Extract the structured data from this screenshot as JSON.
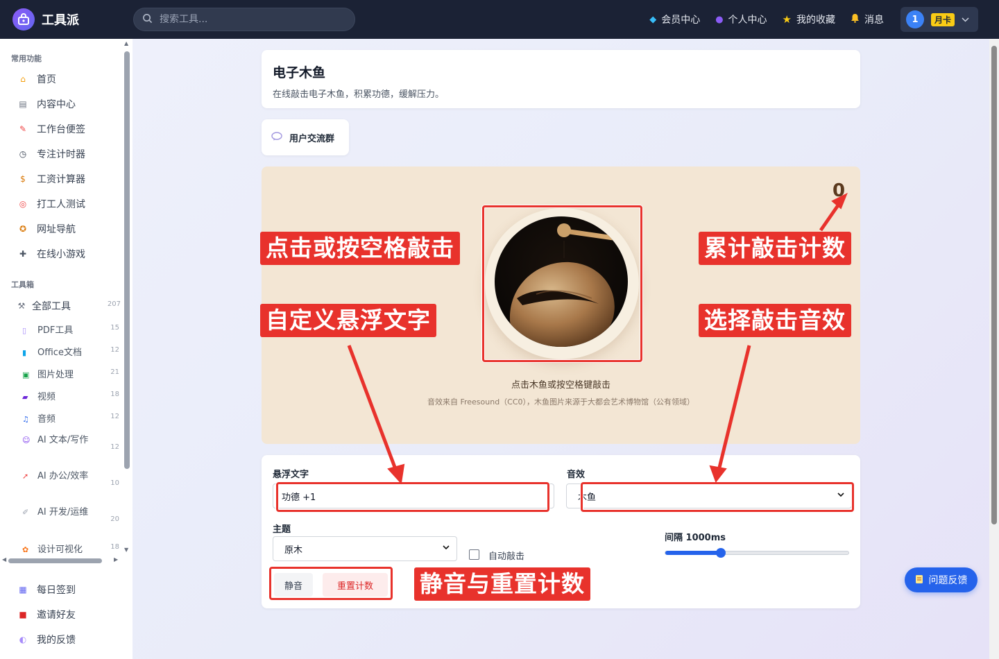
{
  "app": {
    "name": "工具派"
  },
  "search": {
    "placeholder": "搜索工具..."
  },
  "nav": {
    "member": "会员中心",
    "profile": "个人中心",
    "favorites": "我的收藏",
    "messages": "消息",
    "user_number": "1",
    "card_label": "月卡"
  },
  "sidebar": {
    "common_title": "常用功能",
    "common": [
      {
        "label": "首页",
        "icon": "home-icon"
      },
      {
        "label": "内容中心",
        "icon": "newspaper-icon"
      },
      {
        "label": "工作台便签",
        "icon": "memo-icon"
      },
      {
        "label": "专注计时器",
        "icon": "stopwatch-icon"
      },
      {
        "label": "工资计算器",
        "icon": "money-bag-icon"
      },
      {
        "label": "打工人测试",
        "icon": "target-icon"
      },
      {
        "label": "网址导航",
        "icon": "compass-icon"
      },
      {
        "label": "在线小游戏",
        "icon": "gamepad-icon"
      }
    ],
    "toolbox_title": "工具箱",
    "all_tools": {
      "label": "全部工具",
      "count": "207",
      "icon": "hammer-icon"
    },
    "tools": [
      {
        "label": "PDF工具",
        "count": "15",
        "icon": "document-icon"
      },
      {
        "label": "Office文档",
        "count": "12",
        "icon": "book-icon"
      },
      {
        "label": "图片处理",
        "count": "21",
        "icon": "picture-icon"
      },
      {
        "label": "视频",
        "count": "18",
        "icon": "clapper-icon"
      },
      {
        "label": "音频",
        "count": "12",
        "icon": "music-icon"
      },
      {
        "label": "AI 文本/写作",
        "count": "12",
        "icon": "robot-icon"
      },
      {
        "label": "AI 办公/效率",
        "count": "10",
        "icon": "rocket-icon"
      },
      {
        "label": "AI 开发/运维",
        "count": "20",
        "icon": "wrench-icon"
      },
      {
        "label": "设计可视化",
        "count": "18",
        "icon": "palette-icon"
      }
    ],
    "bottom": [
      {
        "label": "每日签到",
        "icon": "calendar-icon"
      },
      {
        "label": "邀请好友",
        "icon": "gift-icon"
      },
      {
        "label": "我的反馈",
        "icon": "speech-bubble-icon"
      }
    ]
  },
  "page": {
    "title": "电子木鱼",
    "subtitle": "在线敲击电子木鱼，积累功德，缓解压力。",
    "group_button": "用户交流群"
  },
  "stage": {
    "count": "0",
    "hint": "点击木鱼或按空格键敲击",
    "credit": "音效来自 Freesound（CC0），木鱼图片来源于大都会艺术博物馆（公有领域）"
  },
  "controls": {
    "float_text_label": "悬浮文字",
    "float_text_value": "功德 +1",
    "sound_label": "音效",
    "sound_value": "木鱼",
    "theme_label": "主题",
    "theme_value": "原木",
    "auto_label": "自动敲击",
    "interval_label": "间隔 1000ms",
    "interval_value": 1000,
    "interval_fraction": 0.3,
    "mute": "静音",
    "reset": "重置计数"
  },
  "feedback": {
    "label": "问题反馈"
  },
  "annotations": {
    "tap": "点击或按空格敲击",
    "count": "累计敲击计数",
    "float": "自定义悬浮文字",
    "sound": "选择敲击音效",
    "mute_reset": "静音与重置计数"
  },
  "colors": {
    "topbar": "#1b2235",
    "accent": "#2563eb",
    "annotation": "#e8322c",
    "stage": "#f3e6d4"
  }
}
